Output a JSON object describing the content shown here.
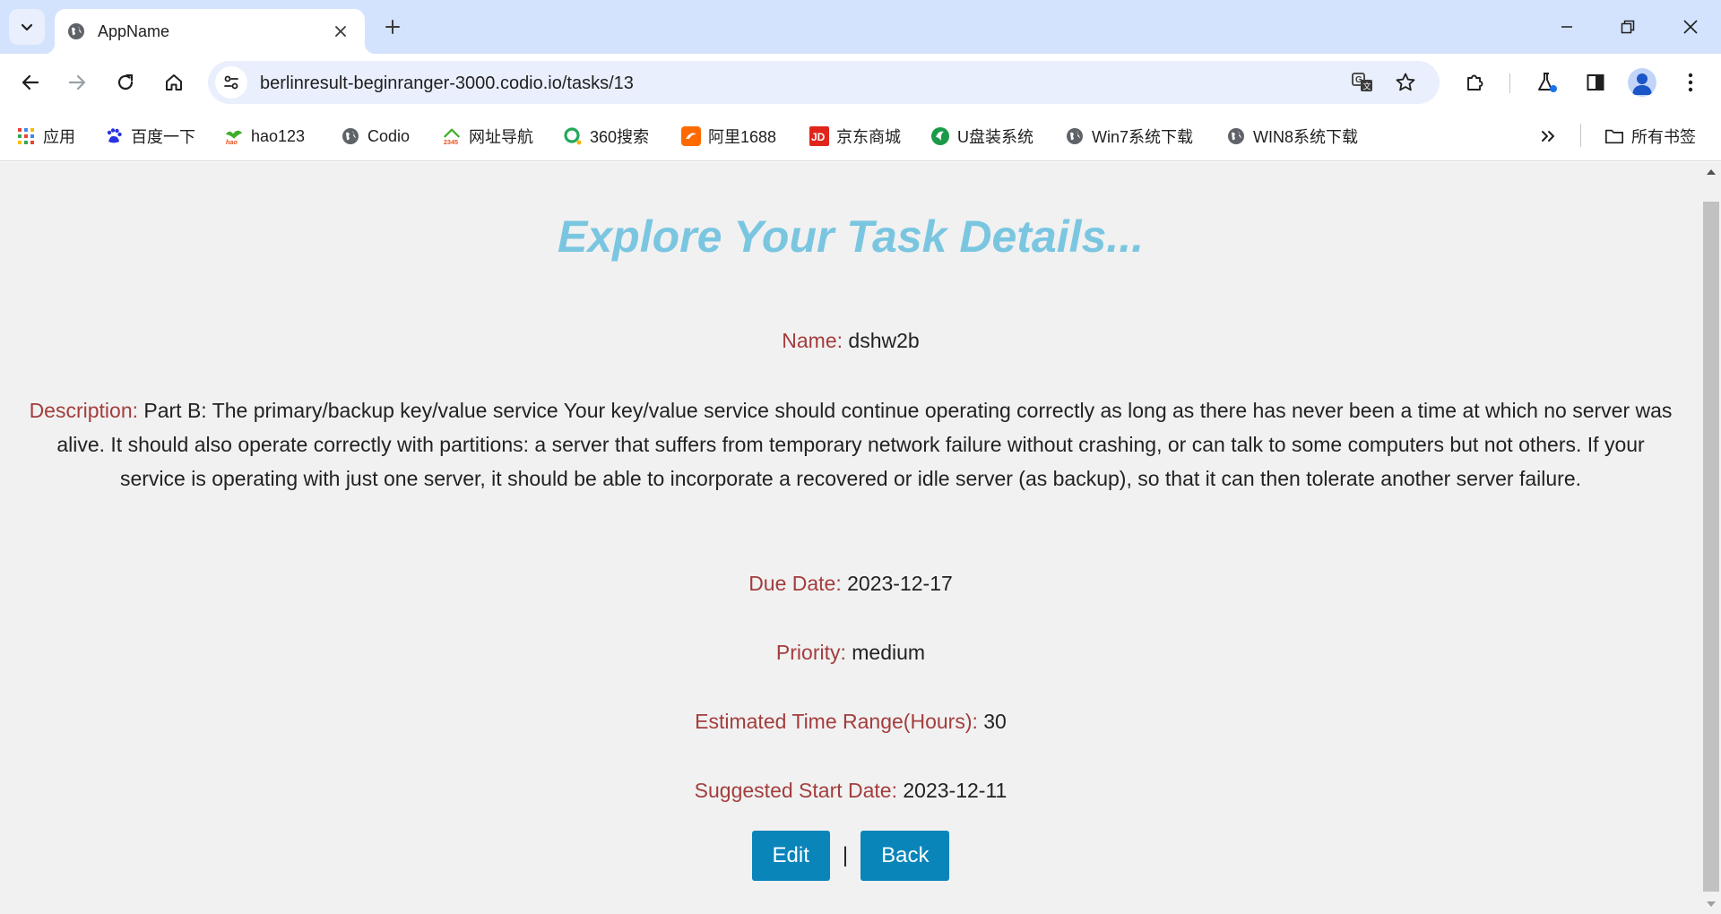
{
  "browser": {
    "tab": {
      "title": "AppName"
    },
    "url": "berlinresult-beginranger-3000.codio.io/tasks/13",
    "bookmarks": [
      {
        "label": "应用",
        "icon": "apps-grid-icon"
      },
      {
        "label": "百度一下",
        "icon": "baidu-paw-icon"
      },
      {
        "label": "hao123",
        "icon": "hao123-icon"
      },
      {
        "label": "Codio",
        "icon": "globe-icon"
      },
      {
        "label": "网址导航",
        "icon": "2345-icon"
      },
      {
        "label": "360搜索",
        "icon": "360-search-icon"
      },
      {
        "label": "阿里1688",
        "icon": "ali1688-icon"
      },
      {
        "label": "京东商城",
        "icon": "jd-icon"
      },
      {
        "label": "U盘装系统",
        "icon": "usb-system-icon"
      },
      {
        "label": "Win7系统下载",
        "icon": "globe-icon"
      },
      {
        "label": "WIN8系统下载",
        "icon": "globe-icon"
      }
    ],
    "all_bookmarks_label": "所有书签"
  },
  "page": {
    "title": "Explore Your Task Details...",
    "fields": {
      "name": {
        "label": "Name:",
        "value": "dshw2b"
      },
      "description": {
        "label": "Description:",
        "value": "Part B: The primary/backup key/value service Your key/value service should continue operating correctly as long as there has never been a time at which no server was alive. It should also operate correctly with partitions: a server that suffers from temporary network failure without crashing, or can talk to some computers but not others. If your service is operating with just one server, it should be able to incorporate a recovered or idle server (as backup), so that it can then tolerate another server failure."
      },
      "due_date": {
        "label": "Due Date:",
        "value": "2023-12-17"
      },
      "priority": {
        "label": "Priority:",
        "value": "medium"
      },
      "estimated_time": {
        "label": "Estimated Time Range(Hours):",
        "value": "30"
      },
      "suggested_start": {
        "label": "Suggested Start Date:",
        "value": "2023-12-11"
      }
    },
    "buttons": {
      "edit": "Edit",
      "separator": "|",
      "back": "Back"
    }
  },
  "colors": {
    "title": "#7ac6e0",
    "label": "#a43d3d",
    "button": "#0a85ba",
    "page_bg": "#f1f1f1",
    "tabstrip_bg": "#d3e3fd"
  }
}
